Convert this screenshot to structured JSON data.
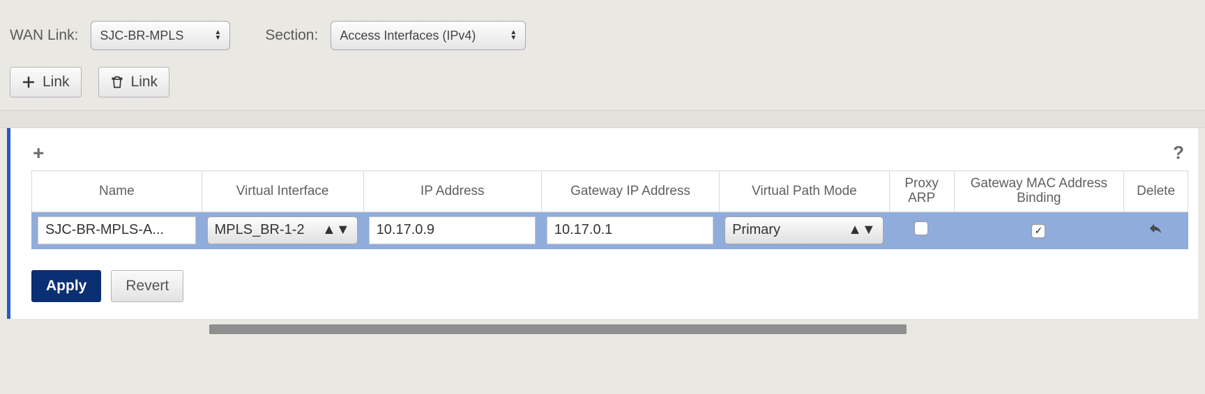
{
  "filters": {
    "wan_link_label": "WAN Link:",
    "wan_link_value": "SJC-BR-MPLS",
    "section_label": "Section:",
    "section_value": "Access Interfaces (IPv4)"
  },
  "toolbar": {
    "add_link_label": "Link",
    "delete_link_label": "Link"
  },
  "table": {
    "headers": {
      "name": "Name",
      "virtual_interface": "Virtual Interface",
      "ip_address": "IP Address",
      "gateway_ip": "Gateway IP Address",
      "virtual_path_mode": "Virtual Path Mode",
      "proxy_arp": "Proxy ARP",
      "gateway_mac_binding": "Gateway MAC Address Binding",
      "delete": "Delete"
    },
    "rows": [
      {
        "name": "SJC-BR-MPLS-A...",
        "virtual_interface": "MPLS_BR-1-2",
        "ip_address": "10.17.0.9",
        "gateway_ip": "10.17.0.1",
        "virtual_path_mode": "Primary",
        "proxy_arp": false,
        "gateway_mac_binding": true
      }
    ]
  },
  "footer": {
    "apply_label": "Apply",
    "revert_label": "Revert"
  },
  "icons": {
    "help": "?",
    "plus": "+",
    "check": "✓"
  }
}
